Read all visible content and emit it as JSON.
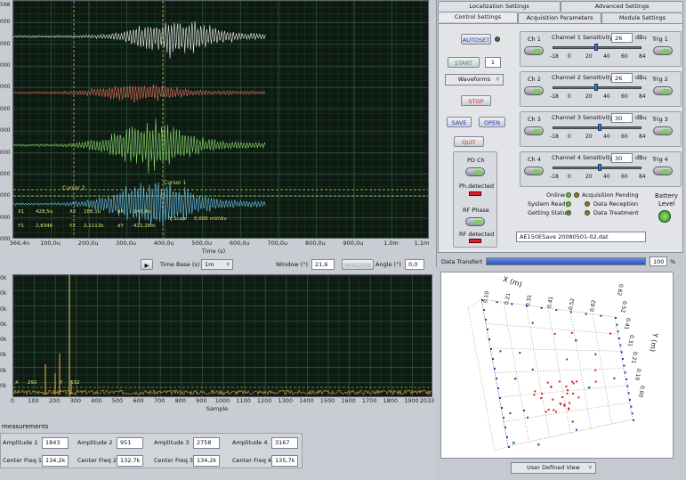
{
  "waveform": {
    "y_ticks": [
      "568",
      "000",
      "000",
      "000",
      "000",
      "000",
      "000",
      "000",
      "000",
      "000",
      "000",
      "000"
    ],
    "x_ticks": [
      "366,4n",
      "100,0u",
      "200,0u",
      "300,0u",
      "400,0u",
      "500,0u",
      "600,0u",
      "700,0u",
      "800,0u",
      "900,0u",
      "1,0m",
      "1,1m"
    ],
    "x_title": "Time (s)",
    "cursor1_label": "Cursor 1",
    "cursor2_label": "Cursor 2",
    "readout": {
      "x1_label": "X1",
      "x1_value": "428,5u",
      "x2_label": "X2",
      "x2_value": "188,1u",
      "dx_label": "dX",
      "dx_value": "-240,4u",
      "y1_label": "Y1",
      "y1_value": "2,8346",
      "y2_label": "Y2",
      "y2_value": "2,1113k",
      "dy_label": "dY",
      "dy_value": "-422,26m",
      "yscale_label": "Y Scale",
      "yscale_value": "0,000 mV/div"
    },
    "trace_colors": [
      "#f4f4f4",
      "#e8705a",
      "#8fe070",
      "#6ec6f0"
    ]
  },
  "timebase": {
    "label": "Time Base (s)",
    "value": "1m",
    "window_label": "Window (°)",
    "window_value": "21,6",
    "window_btn": "WINDOW",
    "angle_label": "Angle (°)",
    "angle_value": "0,0"
  },
  "spectrum": {
    "y_ticks": [
      "0k",
      "0k",
      "0k",
      "0k",
      "0k",
      "0k",
      "0k",
      "0k"
    ],
    "x_ticks": [
      "0",
      "100",
      "200",
      "300",
      "400",
      "500",
      "600",
      "700",
      "800",
      "900",
      "1000",
      "1100",
      "1200",
      "1300",
      "1400",
      "1500",
      "1600",
      "1700",
      "1800",
      "1900",
      "2033"
    ],
    "x_title": "Sample",
    "cursor_x_label": "X",
    "cursor_x_value": "292",
    "cursor_y_label": "Y",
    "cursor_y_value": "532"
  },
  "measurements": {
    "title": "measurements",
    "amplitudes": [
      {
        "label": "Amplitude 1",
        "value": "1843"
      },
      {
        "label": "Amplitude 2",
        "value": "951"
      },
      {
        "label": "Amplitude 3",
        "value": "2758"
      },
      {
        "label": "Amplitude 4",
        "value": "3167"
      }
    ],
    "freqs": [
      {
        "label": "Center Freq 1",
        "value": "134,2k"
      },
      {
        "label": "Center Freq 2",
        "value": "132,7k"
      },
      {
        "label": "Center Freq 3",
        "value": "134,2k"
      },
      {
        "label": "Center Freq 4",
        "value": "135,7k"
      }
    ]
  },
  "tabs": {
    "top": [
      "Localization Settings",
      "Advanced Settings"
    ],
    "bottom": [
      "Control Settings",
      "Acquisition Parameters",
      "Module Settings"
    ]
  },
  "controls": {
    "autoset": "AUTOSET",
    "start": "START",
    "start_count": "1",
    "waveforms": "Waveforms",
    "stop": "STOP",
    "save": "SAVE",
    "open": "OPEN",
    "quit": "QUIT",
    "pd_ch": "PD Ch",
    "ph_detected": "Ph.detected",
    "rf_phase": "RF Phase",
    "rf_detected": "RF detected"
  },
  "channels": [
    {
      "ch": "Ch 1",
      "sens_label": "Channel 1 Sensitivity",
      "value": "26",
      "unit": "dBu",
      "trig": "Trig 1",
      "level": 0.49
    },
    {
      "ch": "Ch 2",
      "sens_label": "Channel 2 Sensitivity",
      "value": "26",
      "unit": "dBu",
      "trig": "Trig 2",
      "level": 0.49
    },
    {
      "ch": "Ch 3",
      "sens_label": "Channel 3 Sensitivity",
      "value": "30",
      "unit": "dBu",
      "trig": "Trig 3",
      "level": 0.53
    },
    {
      "ch": "Ch 4",
      "sens_label": "Channel 4 Sensitivity",
      "value": "30",
      "unit": "dBu",
      "trig": "Trig 4",
      "level": 0.53
    }
  ],
  "slider_scale": [
    "-18",
    "0",
    "20",
    "40",
    "60",
    "84"
  ],
  "status": {
    "online": "Online",
    "system_ready": "System Ready",
    "getting_status": "Getting Status",
    "acq_pending": "Acquisition Pending",
    "data_reception": "Data Reception",
    "data_treatment": "Data Treatment",
    "battery": "Battery",
    "battery_level": "Level"
  },
  "file_path": "AE150ESave 20080501-02.dat",
  "transfer": {
    "label": "Data Transfert",
    "value": "100",
    "unit": "%",
    "fraction": 1.0
  },
  "plot3d": {
    "x_title": "X (m)",
    "y_title": "Y (m)",
    "x_ticks": [
      "0.10",
      "0.21",
      "0.31",
      "0.41",
      "0.52",
      "0.62"
    ],
    "y_ticks": [
      "0.62",
      "0.52",
      "0.41",
      "0.31",
      "0.21",
      "0.10",
      "0.00"
    ],
    "view": "User Defined View"
  }
}
